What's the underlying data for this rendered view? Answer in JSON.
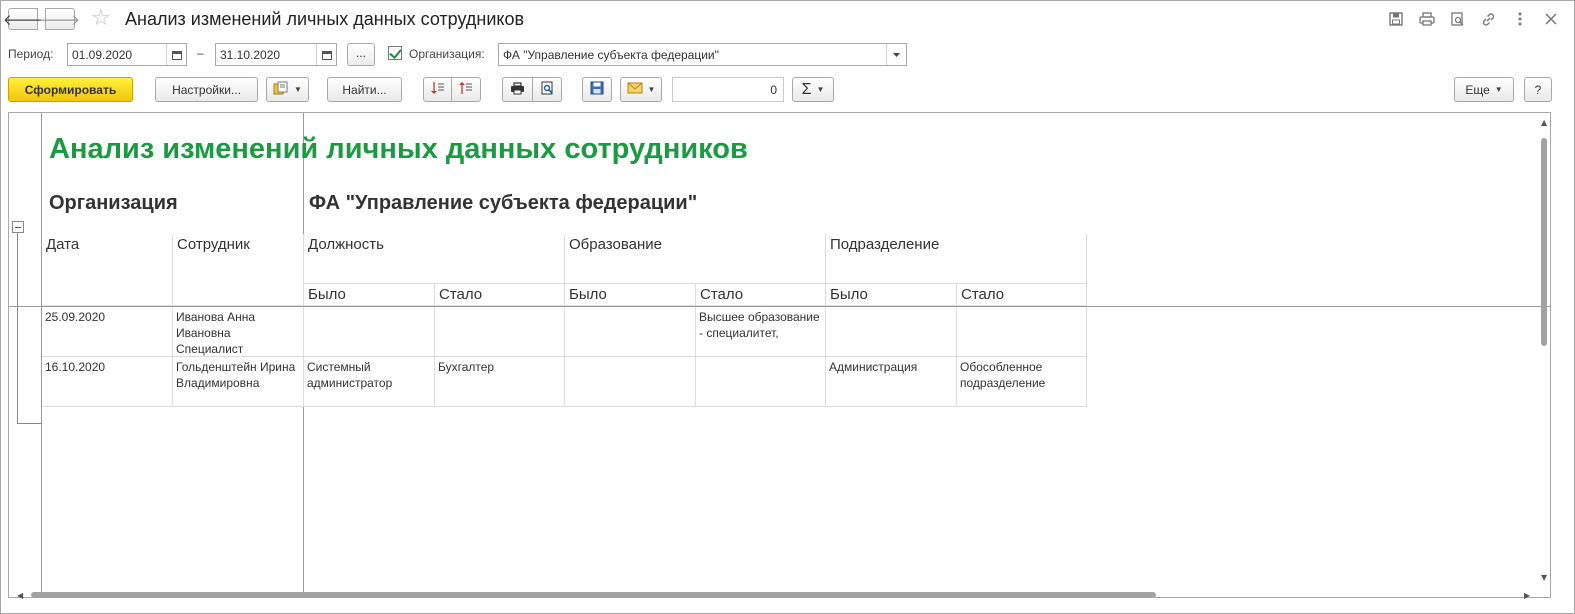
{
  "window": {
    "title": "Анализ изменений личных данных сотрудников"
  },
  "filters": {
    "period_label": "Период:",
    "date_from": "01.09.2020",
    "date_sep": "–",
    "date_to": "31.10.2020",
    "dots_label": "...",
    "org_checked": true,
    "org_label": "Организация:",
    "org_value": "ФА \"Управление субъекта федерации\""
  },
  "toolbar": {
    "generate_label": "Сформировать",
    "settings_label": "Настройки...",
    "find_label": "Найти...",
    "sum_value": "0",
    "sigma_label": "Σ",
    "more_label": "Еще",
    "help_label": "?"
  },
  "report": {
    "title": "Анализ изменений личных данных сотрудников",
    "org_label": "Организация",
    "org_value": "ФА \"Управление субъекта федерации\"",
    "headers": {
      "date": "Дата",
      "employee": "Сотрудник",
      "position": "Должность",
      "education": "Образование",
      "department": "Подразделение",
      "was": "Было",
      "became": "Стало"
    },
    "rows": [
      {
        "date": "25.09.2020",
        "employee": "Иванова Анна Ивановна Специалист",
        "position_was": "",
        "position_became": "",
        "education_was": "",
        "education_became": "Высшее образование - специалитет,",
        "department_was": "",
        "department_became": ""
      },
      {
        "date": "16.10.2020",
        "employee": "Гольденштейн Ирина Владимировна",
        "position_was": "Системный администратор",
        "position_became": "Бухгалтер",
        "education_was": "",
        "education_became": "",
        "department_was": "Администрация",
        "department_became": "Обособленное подразделение"
      }
    ]
  },
  "icons": {
    "back": "arrow-left-icon",
    "forward": "arrow-right-icon",
    "favorite": "star-icon",
    "save": "floppy-icon",
    "print": "printer-icon",
    "preview": "print-preview-icon",
    "link": "link-icon",
    "menu": "more-vertical-icon",
    "close": "close-icon",
    "calendar": "calendar-icon",
    "mail": "envelope-icon"
  },
  "colors": {
    "primary_button": "#f5d10f",
    "report_title": "#1a9a41",
    "checkbox_mark": "#1f8e3c"
  }
}
